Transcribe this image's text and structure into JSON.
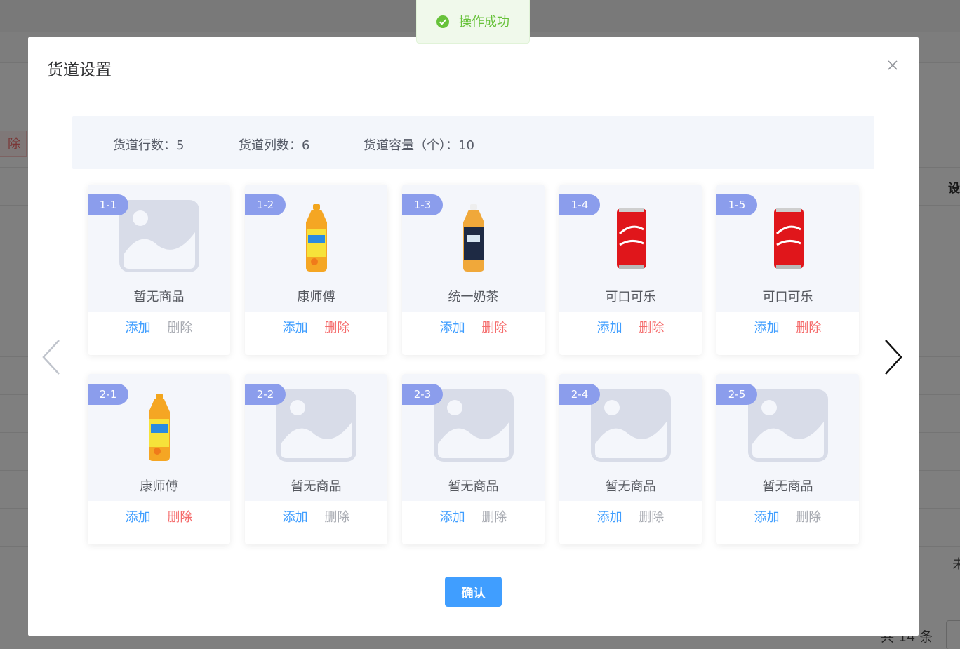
{
  "background": {
    "delete_button_label": "除",
    "column_header": "设",
    "cell_text": "未",
    "total_text": "共 14 条"
  },
  "dialog": {
    "title": "货道设置",
    "info": {
      "rows": "货道行数：5",
      "cols": "货道列数：6",
      "capacity": "货道容量（个）：10"
    },
    "add_label": "添加",
    "delete_label": "删除",
    "confirm_label": "确认",
    "slots": [
      {
        "code": "1-1",
        "name": "暂无商品",
        "product": "placeholder"
      },
      {
        "code": "1-2",
        "name": "康师傅",
        "product": "ice-tea-bottle"
      },
      {
        "code": "1-3",
        "name": "统一奶茶",
        "product": "milk-tea-bottle"
      },
      {
        "code": "1-4",
        "name": "可口可乐",
        "product": "cola-can"
      },
      {
        "code": "1-5",
        "name": "可口可乐",
        "product": "cola-can"
      },
      {
        "code": "2-1",
        "name": "康师傅",
        "product": "ice-tea-bottle"
      },
      {
        "code": "2-2",
        "name": "暂无商品",
        "product": "placeholder"
      },
      {
        "code": "2-3",
        "name": "暂无商品",
        "product": "placeholder"
      },
      {
        "code": "2-4",
        "name": "暂无商品",
        "product": "placeholder"
      },
      {
        "code": "2-5",
        "name": "暂无商品",
        "product": "placeholder"
      }
    ]
  },
  "toast": {
    "message": "操作成功",
    "type": "success"
  },
  "colors": {
    "primary": "#409eff",
    "danger": "#f56c6c",
    "success": "#67c23a",
    "badge": "#8b9dec"
  }
}
